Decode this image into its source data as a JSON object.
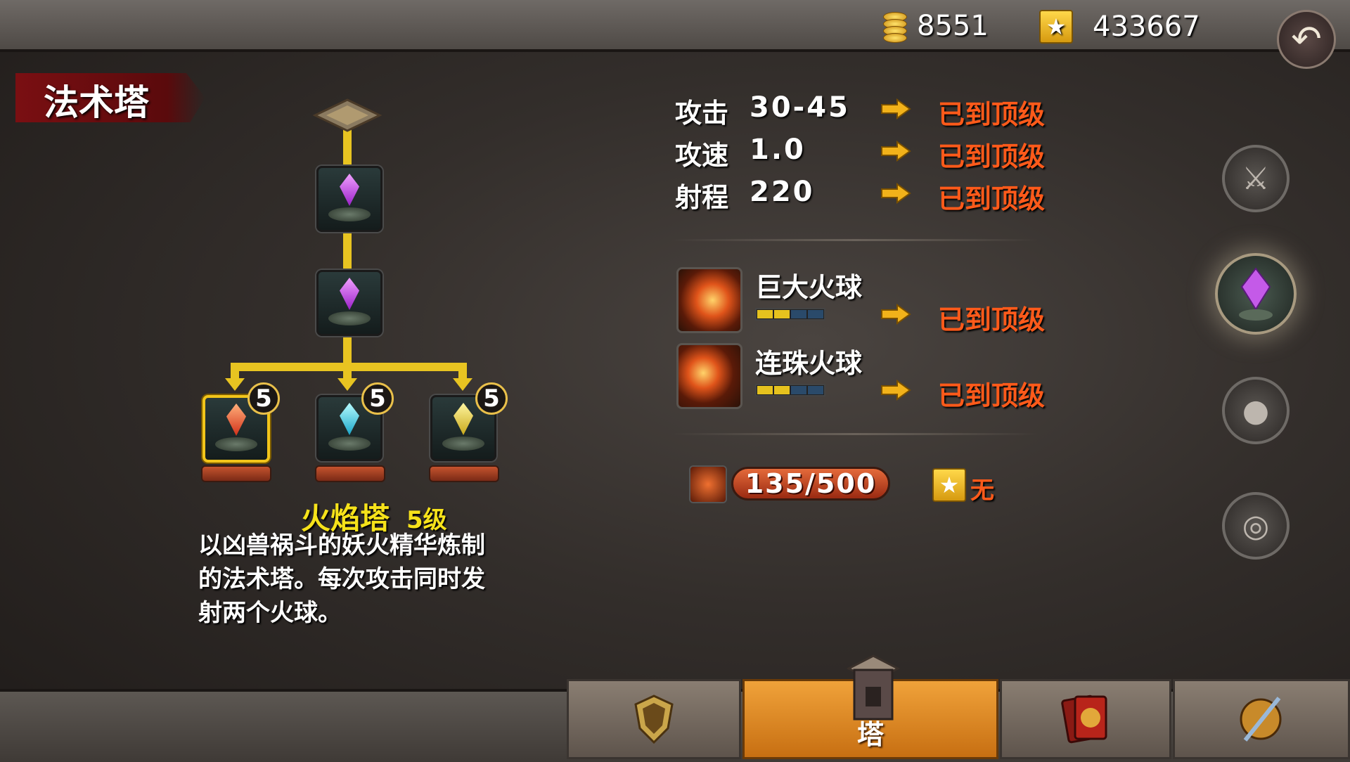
{
  "currency": {
    "gold": "8551",
    "stars": "433667"
  },
  "icons": {
    "back": "back-arrow-icon",
    "gold": "gold-coin-icon",
    "star": "star-icon"
  },
  "panel_title": "法术塔",
  "tree": {
    "badges": [
      "5",
      "5",
      "5"
    ]
  },
  "tower": {
    "name": "火焰塔",
    "level": "5级",
    "description": "以凶兽祸斗的妖火精华炼制的法术塔。每次攻击同时发射两个火球。"
  },
  "stats": [
    {
      "label": "攻击",
      "value": "30-45",
      "next": "已到顶级"
    },
    {
      "label": "攻速",
      "value": "1.0",
      "next": "已到顶级"
    },
    {
      "label": "射程",
      "value": "220",
      "next": "已到顶级"
    }
  ],
  "skills": [
    {
      "name": "巨大火球",
      "level_filled": 2,
      "level_max": 4,
      "next": "已到顶级"
    },
    {
      "name": "连珠火球",
      "level_filled": 2,
      "level_max": 4,
      "next": "已到顶级"
    }
  ],
  "experience": {
    "value": "135/500",
    "star_cost": "无"
  },
  "bottom_tabs": {
    "active_label": "塔"
  },
  "colors": {
    "accent_yellow": "#e8c421",
    "maxed_red": "#ff5a1a",
    "active_tab": "#f0a23a"
  }
}
